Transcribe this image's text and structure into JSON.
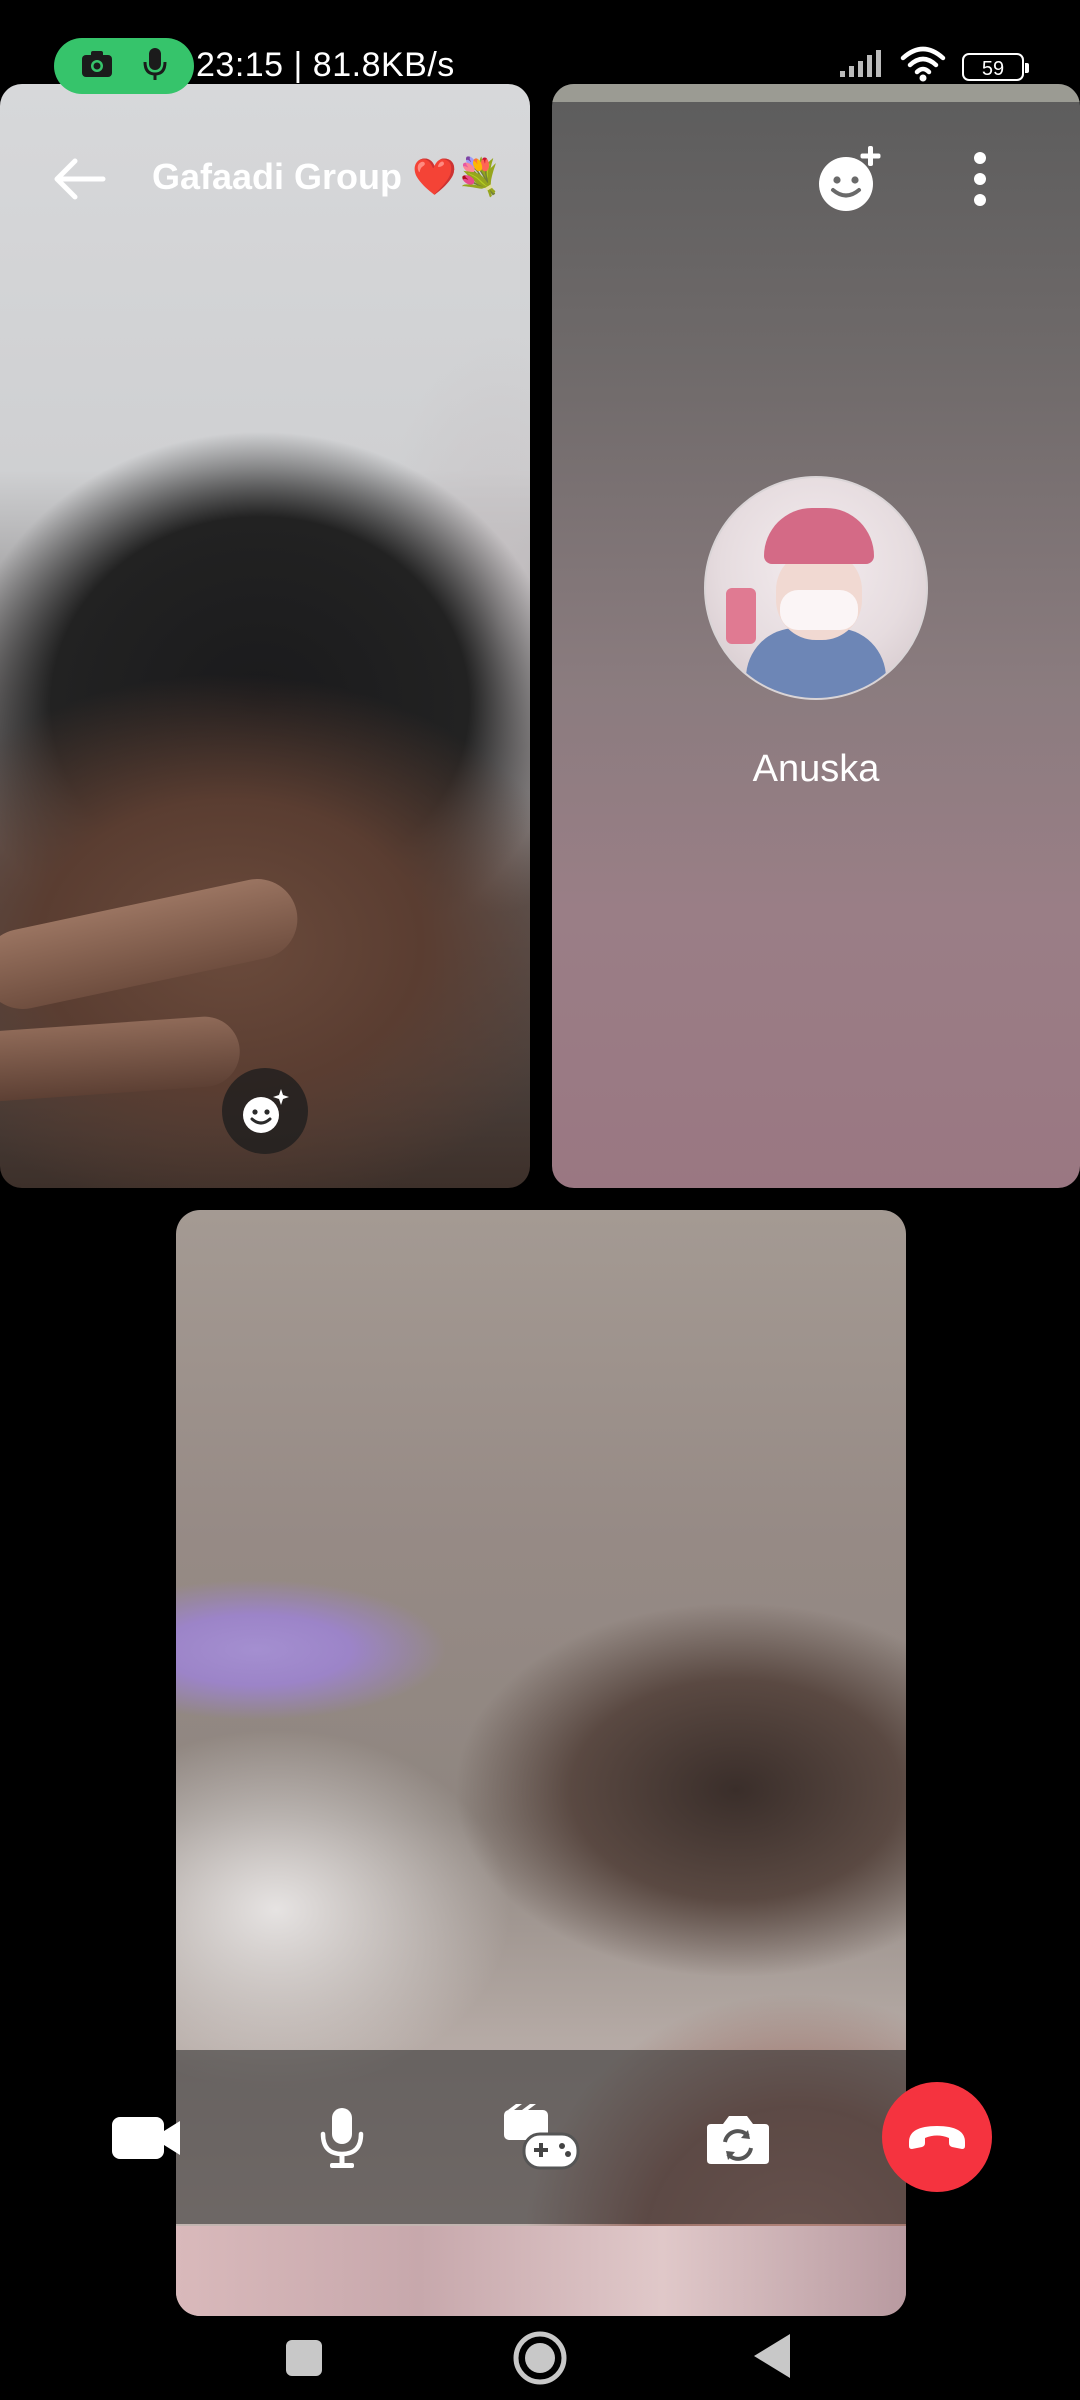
{
  "status_bar": {
    "time_speed": "23:15 | 81.8KB/s",
    "battery": "59",
    "rec_icons": [
      "camera-icon",
      "mic-icon"
    ],
    "icons": [
      "signal-icon",
      "wifi-icon",
      "battery-icon"
    ]
  },
  "call": {
    "group_title": "Gafaadi Group",
    "title_emoji": [
      "❤️",
      "💐"
    ],
    "participants": [
      {
        "tile": "self"
      },
      {
        "tile": "avatar",
        "name": "Anuska"
      },
      {
        "tile": "remote"
      }
    ]
  },
  "controls": {
    "items": [
      "video-camera-icon",
      "microphone-icon",
      "games-icon",
      "flip-camera-icon",
      "end-call-icon"
    ]
  },
  "colors": {
    "end_call": "#f5333f",
    "rec_pill": "#36c46b"
  },
  "nav": {
    "items": [
      "recents-icon",
      "home-icon",
      "back-icon"
    ]
  }
}
